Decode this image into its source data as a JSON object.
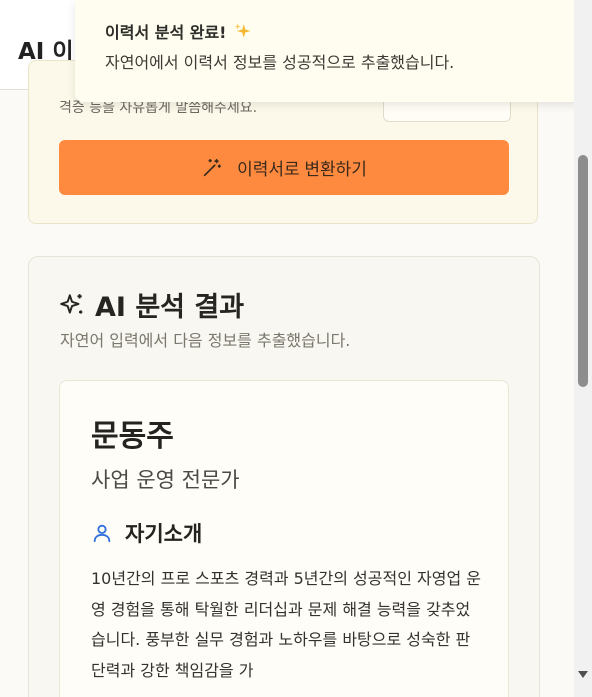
{
  "header": {
    "title": "AI 이"
  },
  "input_card": {
    "hint": "격증 등을 자유롭게 말씀해주세요.",
    "convert_button_label": "이력서로 변환하기",
    "convert_icon": "magic-wand-icon",
    "accent_color": "#fd8a3f"
  },
  "result": {
    "heading": "AI 분석 결과",
    "heading_icon": "sparkles-icon",
    "subtitle": "자연어 입력에서 다음 정보를 추출했습니다.",
    "resume": {
      "name": "문동주",
      "role": "사업 운영 전문가",
      "section_title": "자기소개",
      "section_icon": "user-icon",
      "intro": "10년간의 프로 스포츠 경력과 5년간의 성공적인 자영업 운영 경험을 통해 탁월한 리더십과 문제 해결 능력을 갖추었습니다. 풍부한 실무 경험과 노하우를 바탕으로 성숙한 판단력과 강한 책임감을 가"
    }
  },
  "toast": {
    "title": "이력서 분석 완료!",
    "title_icon": "sparkle-emoji-icon",
    "message": "자연어에서 이력서 정보를 성공적으로 추출했습니다."
  }
}
